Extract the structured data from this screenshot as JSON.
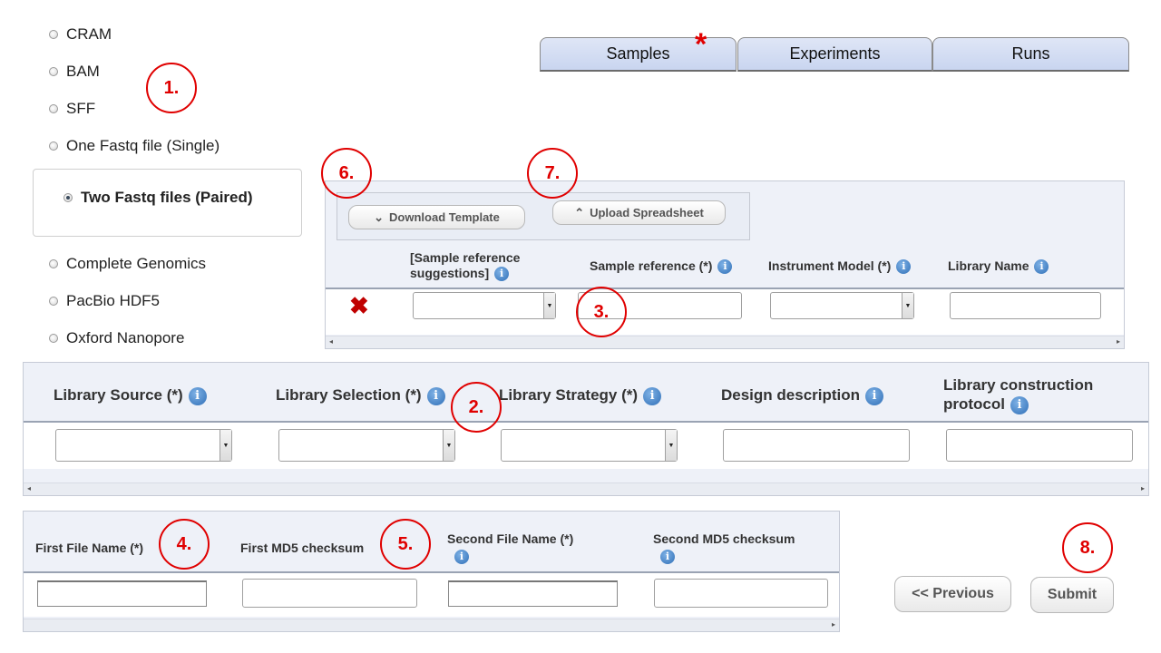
{
  "file_types": [
    {
      "label": "CRAM",
      "checked": false
    },
    {
      "label": "BAM",
      "checked": false
    },
    {
      "label": "SFF",
      "checked": false
    },
    {
      "label": "One Fastq file (Single)",
      "checked": false
    },
    {
      "label": "Two Fastq files (Paired)",
      "checked": true
    },
    {
      "label": "Complete Genomics",
      "checked": false
    },
    {
      "label": "PacBio HDF5",
      "checked": false
    },
    {
      "label": "Oxford Nanopore",
      "checked": false
    }
  ],
  "tabs": [
    {
      "label": "Samples",
      "required_marker": "*"
    },
    {
      "label": "Experiments"
    },
    {
      "label": "Runs"
    }
  ],
  "toolbar": {
    "download_label": "Download Template",
    "upload_label": "Upload Spreadsheet"
  },
  "samples_table": {
    "columns": [
      "[Sample reference suggestions]",
      "Sample reference (*)",
      "Instrument Model (*)",
      "Library Name"
    ],
    "delete_glyph": "✖"
  },
  "library_table": {
    "columns": [
      "Library Source (*)",
      "Library Selection (*)",
      "Library Strategy (*)",
      "Design description",
      "Library construction protocol"
    ]
  },
  "files_table": {
    "columns": [
      "First File Name (*)",
      "First MD5 checksum",
      "Second File Name (*)",
      "Second MD5 checksum"
    ]
  },
  "nav": {
    "previous_label": "<< Previous",
    "submit_label": "Submit"
  },
  "annotations": [
    "1.",
    "2.",
    "3.",
    "4.",
    "5.",
    "6.",
    "7.",
    "8."
  ],
  "colors": {
    "annotation": "#e00000",
    "tab_bg": "#c9d5f0",
    "panel_bg": "#eef1f8",
    "info_icon": "#2f6fb7"
  }
}
